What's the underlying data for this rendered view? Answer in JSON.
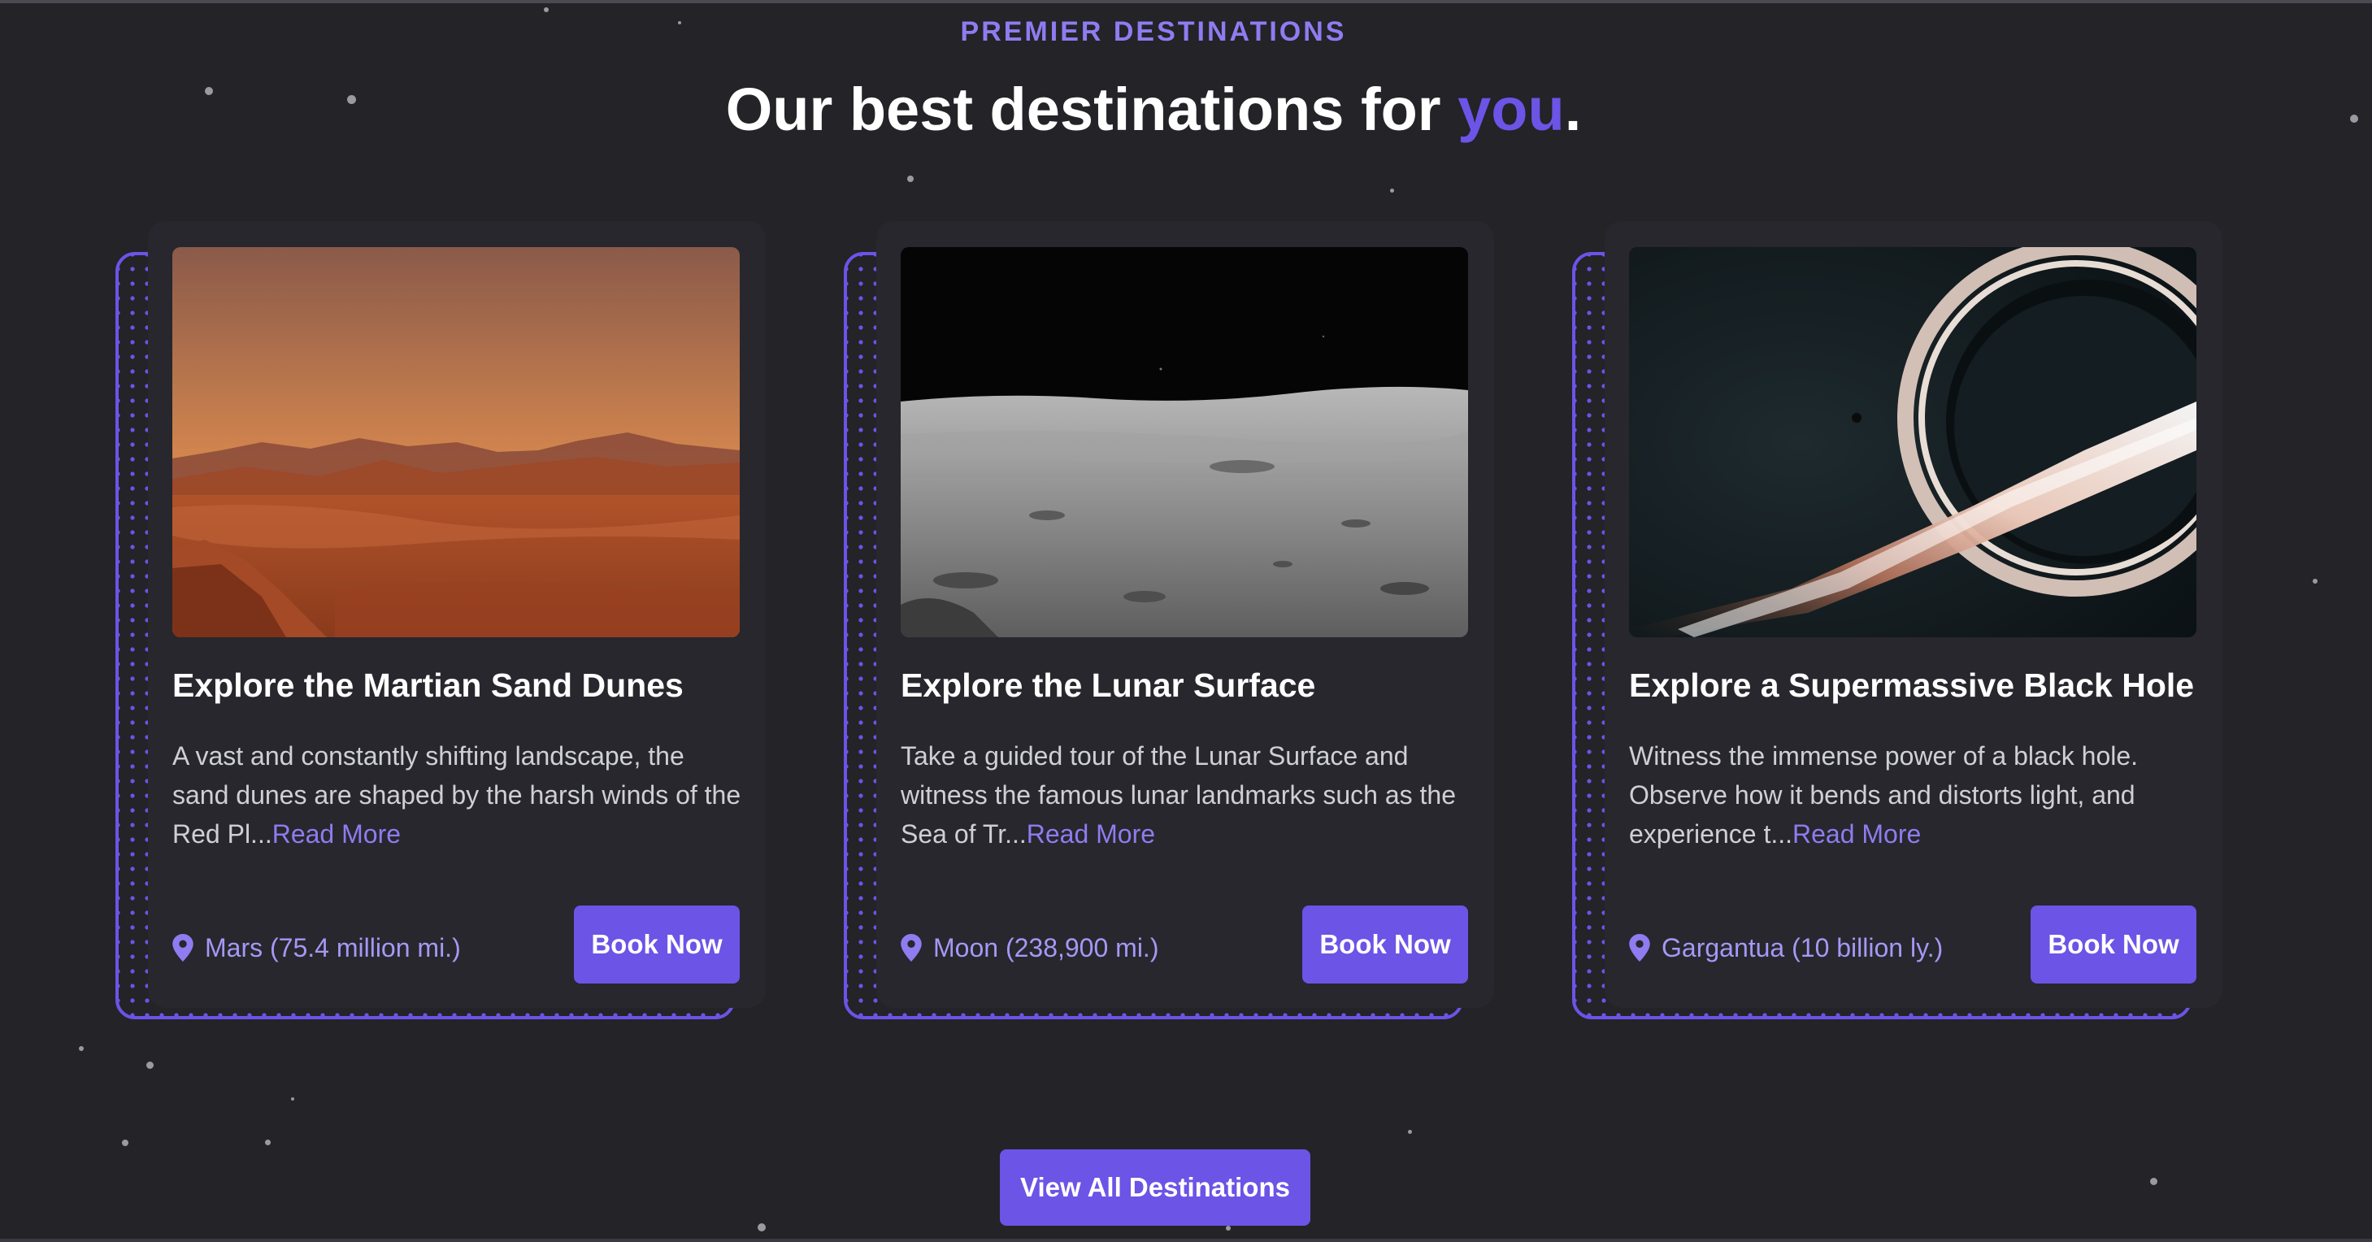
{
  "section": {
    "eyebrow": "PREMIER DESTINATIONS",
    "headline_prefix": "Our best destinations for ",
    "headline_accent": "you",
    "headline_suffix": "."
  },
  "colors": {
    "accent": "#6b54e6",
    "accent_light": "#8e7cf0",
    "background": "#232328",
    "card": "#27272d"
  },
  "cards": [
    {
      "image": "martian-sand-dunes-photo",
      "title": "Explore the Martian Sand Dunes",
      "description": "A vast and constantly shifting landscape, the sand dunes are shaped by the harsh winds of the Red Pl...",
      "read_more": "Read More",
      "location_icon": "map-pin-icon",
      "location": "Mars (75.4 million mi.)",
      "cta": "Book Now"
    },
    {
      "image": "lunar-surface-photo",
      "title": "Explore the Lunar Surface",
      "description": "Take a guided tour of the Lunar Surface and witness the famous lunar landmarks such as the Sea of Tr...",
      "read_more": "Read More",
      "location_icon": "map-pin-icon",
      "location": "Moon (238,900 mi.)",
      "cta": "Book Now"
    },
    {
      "image": "supermassive-black-hole-image",
      "title": "Explore a Supermassive Black Hole",
      "description": "Witness the immense power of a black hole. Observe how it bends and distorts light, and experience t...",
      "read_more": "Read More",
      "location_icon": "map-pin-icon",
      "location": "Gargantua (10 billion ly.)",
      "cta": "Book Now"
    }
  ],
  "footer_cta": "View All Destinations"
}
